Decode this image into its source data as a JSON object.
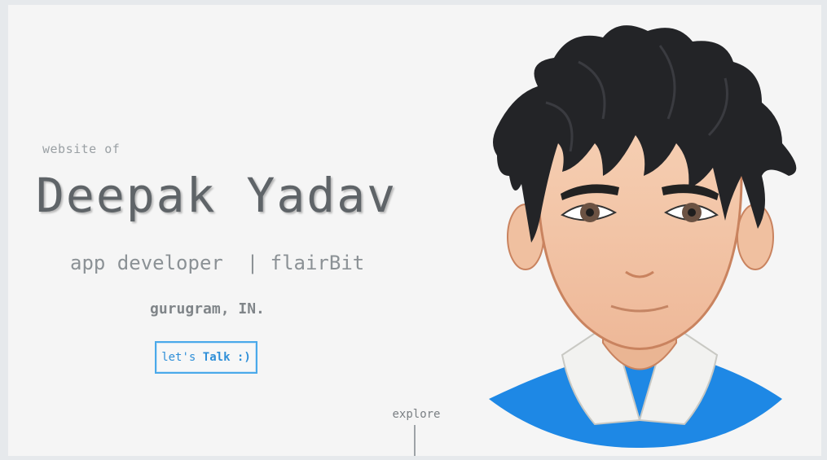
{
  "hero": {
    "intro": "website of",
    "name": "Deepak Yadav",
    "role": "app developer  | flairBit",
    "location": "gurugram, IN.",
    "cta_prefix": "let's ",
    "cta_bold": "Talk :)",
    "explore": "explore"
  },
  "colors": {
    "background": "#f5f5f5",
    "name": "#5f6468",
    "accent": "#2f8fd8",
    "shirt": "#1e88e5"
  },
  "avatar": {
    "icon": "cartoon-avatar-icon"
  }
}
